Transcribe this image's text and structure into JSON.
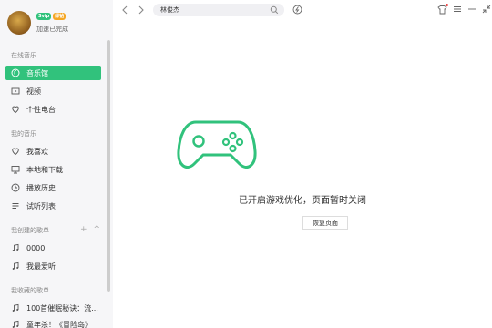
{
  "user": {
    "status": "加速已完成",
    "badge1": "Svip",
    "badge2": "绿钻"
  },
  "sidebar": {
    "sections": [
      {
        "title": "在线音乐",
        "items": [
          {
            "label": "音乐馆",
            "icon": "music-hall-icon",
            "active": true
          },
          {
            "label": "视频",
            "icon": "video-icon"
          },
          {
            "label": "个性电台",
            "icon": "radio-icon"
          }
        ]
      },
      {
        "title": "我的音乐",
        "items": [
          {
            "label": "我喜欢",
            "icon": "heart-icon"
          },
          {
            "label": "本地和下载",
            "icon": "monitor-icon"
          },
          {
            "label": "播放历史",
            "icon": "clock-icon"
          },
          {
            "label": "试听列表",
            "icon": "list-icon"
          }
        ]
      },
      {
        "title": "我创建的歌单",
        "add": "+",
        "collapse": "^",
        "items": [
          {
            "label": "0000",
            "icon": "music-note-icon"
          },
          {
            "label": "我最爱听",
            "icon": "music-note-icon"
          }
        ]
      },
      {
        "title": "我收藏的歌单",
        "items": [
          {
            "label": "100首催眠秘诀：流...",
            "icon": "music-note-icon"
          },
          {
            "label": "童年杀！《冒险岛》",
            "icon": "music-note-icon"
          }
        ]
      }
    ]
  },
  "header": {
    "search_value": "林俊杰",
    "icons": [
      "back-icon",
      "forward-icon",
      "search-icon",
      "recognize-icon",
      "skin-icon",
      "menu-icon",
      "minimize-icon",
      "mini-mode-icon"
    ]
  },
  "main": {
    "message": "已开启游戏优化，页面暂时关闭",
    "restore_label": "恢复页面",
    "accent_color": "#31c27c"
  }
}
